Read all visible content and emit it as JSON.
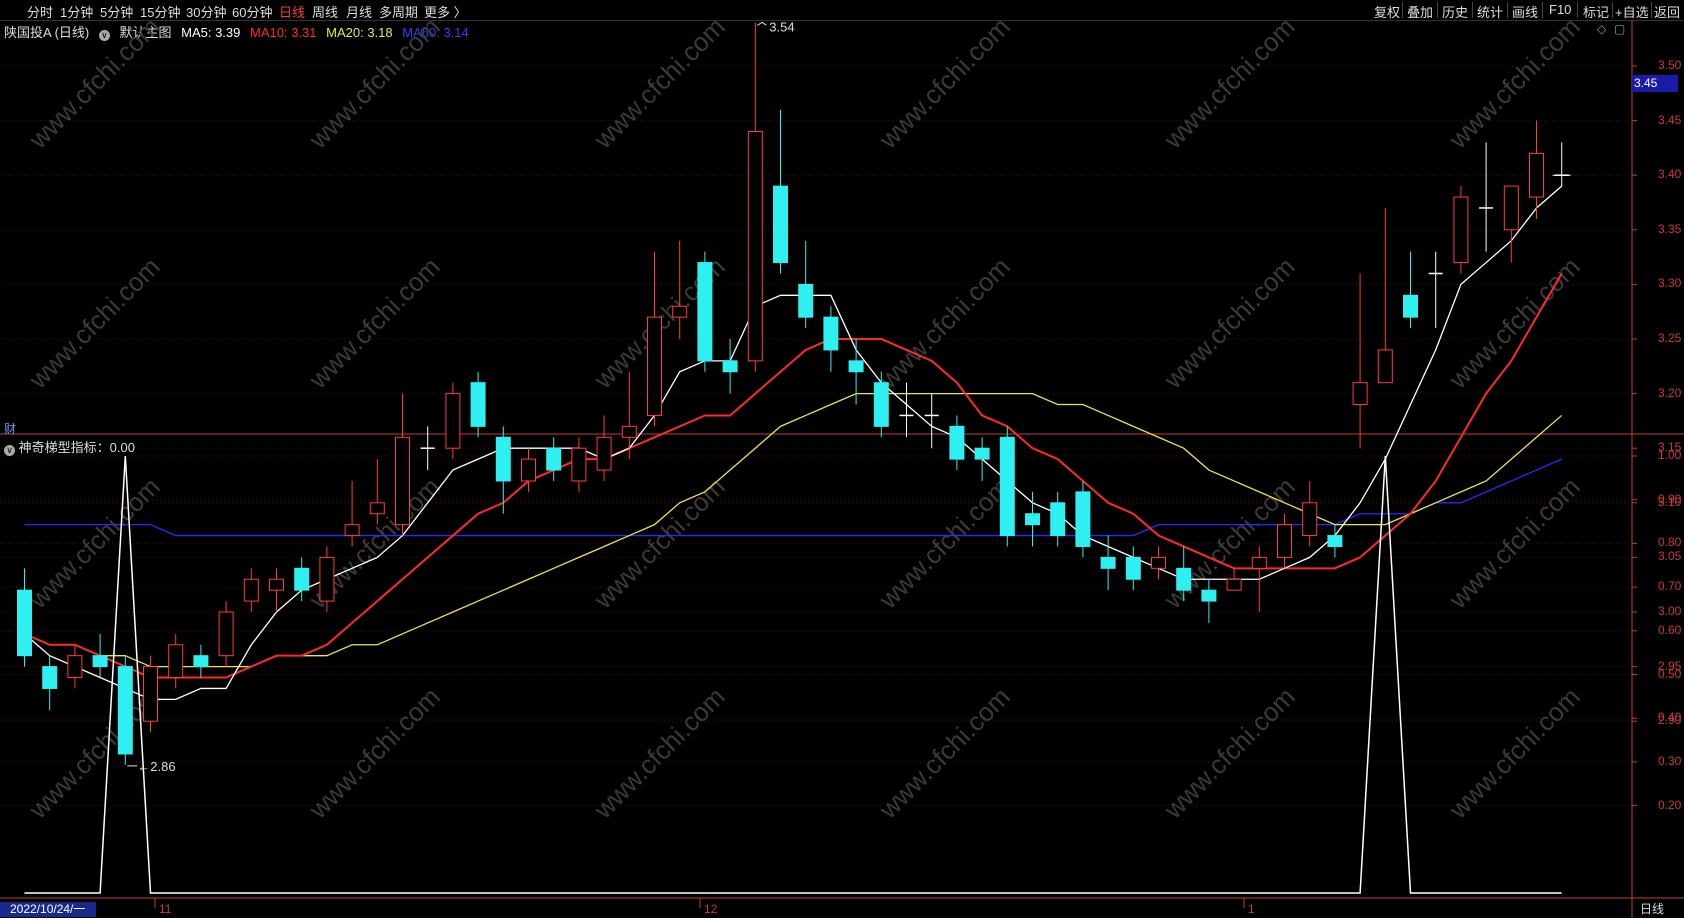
{
  "periods": [
    {
      "label": "分时",
      "active": false
    },
    {
      "label": "1分钟",
      "active": false
    },
    {
      "label": "5分钟",
      "active": false
    },
    {
      "label": "15分钟",
      "active": false
    },
    {
      "label": "30分钟",
      "active": false
    },
    {
      "label": "60分钟",
      "active": false
    },
    {
      "label": "日线",
      "active": true
    },
    {
      "label": "周线",
      "active": false
    },
    {
      "label": "月线",
      "active": false
    },
    {
      "label": "多周期",
      "active": false
    },
    {
      "label": "更多 〉",
      "active": false
    }
  ],
  "tools": [
    "复权",
    "叠加",
    "历史",
    "统计",
    "画线",
    "F10",
    "标记",
    "+自选",
    "返回"
  ],
  "legend": {
    "stock": "陕国投A (日线)",
    "template_label": "默认主图",
    "ma5": "MA5: 3.39",
    "ma10": "MA10: 3.31",
    "ma20": "MA20: 3.18",
    "ma60": "MA60: 3.14"
  },
  "colors": {
    "ma5": "#ffffff",
    "ma10": "#ff2a2a",
    "ma20": "#e8e83a",
    "ma60": "#2a2aff",
    "up": "#ff3b3b",
    "down": "#2ff0f0",
    "axis": "#c83a3a",
    "grid": "#5a0000"
  },
  "price_axis": [
    "3.50",
    "3.45",
    "3.40",
    "3.35",
    "3.30",
    "3.25",
    "3.20",
    "3.15",
    "3.10",
    "3.05",
    "3.00",
    "2.95",
    "2.90"
  ],
  "current_price": "3.45",
  "annotations": {
    "high": "3.54",
    "low": "2.86"
  },
  "indicator": {
    "label": "神奇梯型指标：0.00",
    "axis": [
      "1.00",
      "0.90",
      "0.80",
      "0.70",
      "0.60",
      "0.50",
      "0.40",
      "0.30",
      "0.20"
    ],
    "cai": "财"
  },
  "date_axis": {
    "start": "2022/10/24/一",
    "months": [
      "11",
      "12",
      "1"
    ]
  },
  "bottom_tab": "日线",
  "chart_data": {
    "type": "candlestick",
    "ylim": [
      2.86,
      3.54
    ],
    "candles": [
      [
        3.02,
        2.96,
        3.04,
        2.95
      ],
      [
        2.95,
        2.93,
        2.96,
        2.91
      ],
      [
        2.94,
        2.96,
        2.97,
        2.93
      ],
      [
        2.96,
        2.95,
        2.98,
        2.94
      ],
      [
        2.95,
        2.87,
        2.96,
        2.86
      ],
      [
        2.9,
        2.95,
        2.96,
        2.89
      ],
      [
        2.94,
        2.97,
        2.98,
        2.93
      ],
      [
        2.96,
        2.95,
        2.97,
        2.94
      ],
      [
        2.96,
        3.0,
        3.01,
        2.95
      ],
      [
        3.01,
        3.03,
        3.04,
        3.0
      ],
      [
        3.02,
        3.03,
        3.04,
        3.0
      ],
      [
        3.04,
        3.02,
        3.05,
        3.01
      ],
      [
        3.01,
        3.05,
        3.06,
        3.0
      ],
      [
        3.07,
        3.08,
        3.12,
        3.06
      ],
      [
        3.09,
        3.1,
        3.14,
        3.08
      ],
      [
        3.08,
        3.16,
        3.2,
        3.07
      ],
      [
        3.15,
        3.15,
        3.17,
        3.13
      ],
      [
        3.15,
        3.2,
        3.21,
        3.14
      ],
      [
        3.21,
        3.17,
        3.22,
        3.16
      ],
      [
        3.16,
        3.12,
        3.17,
        3.09
      ],
      [
        3.12,
        3.14,
        3.15,
        3.11
      ],
      [
        3.15,
        3.13,
        3.16,
        3.12
      ],
      [
        3.12,
        3.15,
        3.16,
        3.11
      ],
      [
        3.13,
        3.16,
        3.18,
        3.12
      ],
      [
        3.16,
        3.17,
        3.22,
        3.14
      ],
      [
        3.18,
        3.27,
        3.33,
        3.17
      ],
      [
        3.27,
        3.28,
        3.34,
        3.25
      ],
      [
        3.32,
        3.23,
        3.33,
        3.22
      ],
      [
        3.23,
        3.22,
        3.25,
        3.2
      ],
      [
        3.23,
        3.44,
        3.54,
        3.22
      ],
      [
        3.39,
        3.32,
        3.46,
        3.31
      ],
      [
        3.3,
        3.27,
        3.34,
        3.26
      ],
      [
        3.27,
        3.24,
        3.28,
        3.22
      ],
      [
        3.23,
        3.22,
        3.25,
        3.19
      ],
      [
        3.21,
        3.17,
        3.22,
        3.16
      ],
      [
        3.18,
        3.18,
        3.21,
        3.16
      ],
      [
        3.18,
        3.18,
        3.2,
        3.15
      ],
      [
        3.17,
        3.14,
        3.18,
        3.13
      ],
      [
        3.15,
        3.14,
        3.16,
        3.12
      ],
      [
        3.16,
        3.07,
        3.17,
        3.06
      ],
      [
        3.09,
        3.08,
        3.11,
        3.06
      ],
      [
        3.1,
        3.07,
        3.11,
        3.06
      ],
      [
        3.11,
        3.06,
        3.12,
        3.05
      ],
      [
        3.05,
        3.04,
        3.07,
        3.02
      ],
      [
        3.05,
        3.03,
        3.06,
        3.02
      ],
      [
        3.04,
        3.05,
        3.06,
        3.03
      ],
      [
        3.04,
        3.02,
        3.06,
        3.01
      ],
      [
        3.02,
        3.01,
        3.03,
        2.99
      ],
      [
        3.02,
        3.03,
        3.04,
        3.02
      ],
      [
        3.04,
        3.05,
        3.06,
        3.0
      ],
      [
        3.05,
        3.08,
        3.09,
        3.04
      ],
      [
        3.07,
        3.1,
        3.12,
        3.06
      ],
      [
        3.07,
        3.06,
        3.08,
        3.05
      ],
      [
        3.19,
        3.21,
        3.31,
        3.15
      ],
      [
        3.21,
        3.24,
        3.37,
        3.21
      ],
      [
        3.29,
        3.27,
        3.33,
        3.26
      ],
      [
        3.31,
        3.31,
        3.33,
        3.26
      ],
      [
        3.32,
        3.38,
        3.39,
        3.31
      ],
      [
        3.37,
        3.37,
        3.43,
        3.33
      ],
      [
        3.35,
        3.39,
        3.39,
        3.32
      ],
      [
        3.38,
        3.42,
        3.45,
        3.36
      ],
      [
        3.4,
        3.4,
        3.43,
        3.39
      ]
    ],
    "ma5": [
      2.98,
      2.96,
      2.95,
      2.94,
      2.93,
      2.92,
      2.92,
      2.93,
      2.93,
      2.97,
      3.0,
      3.02,
      3.03,
      3.04,
      3.05,
      3.07,
      3.1,
      3.13,
      3.14,
      3.15,
      3.15,
      3.15,
      3.15,
      3.14,
      3.15,
      3.18,
      3.22,
      3.23,
      3.23,
      3.28,
      3.29,
      3.29,
      3.29,
      3.24,
      3.21,
      3.19,
      3.17,
      3.16,
      3.14,
      3.12,
      3.1,
      3.09,
      3.07,
      3.06,
      3.05,
      3.04,
      3.03,
      3.03,
      3.03,
      3.03,
      3.04,
      3.05,
      3.07,
      3.1,
      3.14,
      3.19,
      3.24,
      3.3,
      3.32,
      3.34,
      3.37,
      3.39
    ],
    "ma10": [
      2.98,
      2.97,
      2.97,
      2.96,
      2.95,
      2.94,
      2.94,
      2.94,
      2.94,
      2.95,
      2.96,
      2.96,
      2.97,
      2.99,
      3.01,
      3.03,
      3.05,
      3.07,
      3.09,
      3.1,
      3.12,
      3.13,
      3.14,
      3.14,
      3.15,
      3.16,
      3.17,
      3.18,
      3.18,
      3.2,
      3.22,
      3.24,
      3.25,
      3.25,
      3.25,
      3.24,
      3.23,
      3.21,
      3.18,
      3.17,
      3.15,
      3.14,
      3.12,
      3.1,
      3.09,
      3.07,
      3.06,
      3.05,
      3.04,
      3.04,
      3.04,
      3.04,
      3.04,
      3.05,
      3.07,
      3.09,
      3.12,
      3.16,
      3.2,
      3.23,
      3.27,
      3.31
    ],
    "ma20": [
      2.98,
      2.97,
      2.97,
      2.96,
      2.96,
      2.95,
      2.95,
      2.95,
      2.95,
      2.95,
      2.96,
      2.96,
      2.96,
      2.97,
      2.97,
      2.98,
      2.99,
      3.0,
      3.01,
      3.02,
      3.03,
      3.04,
      3.05,
      3.06,
      3.07,
      3.08,
      3.1,
      3.11,
      3.13,
      3.15,
      3.17,
      3.18,
      3.19,
      3.2,
      3.2,
      3.2,
      3.2,
      3.2,
      3.2,
      3.2,
      3.2,
      3.19,
      3.19,
      3.18,
      3.17,
      3.16,
      3.15,
      3.13,
      3.12,
      3.11,
      3.1,
      3.09,
      3.08,
      3.08,
      3.08,
      3.09,
      3.1,
      3.11,
      3.12,
      3.14,
      3.16,
      3.18
    ],
    "ma60": [
      3.08,
      3.08,
      3.08,
      3.08,
      3.08,
      3.08,
      3.07,
      3.07,
      3.07,
      3.07,
      3.07,
      3.07,
      3.07,
      3.07,
      3.07,
      3.07,
      3.07,
      3.07,
      3.07,
      3.07,
      3.07,
      3.07,
      3.07,
      3.07,
      3.07,
      3.07,
      3.07,
      3.07,
      3.07,
      3.07,
      3.07,
      3.07,
      3.07,
      3.07,
      3.07,
      3.07,
      3.07,
      3.07,
      3.07,
      3.07,
      3.07,
      3.07,
      3.07,
      3.07,
      3.07,
      3.08,
      3.08,
      3.08,
      3.08,
      3.08,
      3.08,
      3.08,
      3.08,
      3.09,
      3.09,
      3.09,
      3.1,
      3.1,
      3.11,
      3.12,
      3.13,
      3.14
    ],
    "indicator": [
      0,
      0,
      0,
      0,
      1,
      0,
      0,
      0,
      0,
      0,
      0,
      0,
      0,
      0,
      0,
      0,
      0,
      0,
      0,
      0,
      0,
      0,
      0,
      0,
      0,
      0,
      0,
      0,
      0,
      0,
      0,
      0,
      0,
      0,
      0,
      0,
      0,
      0,
      0,
      0,
      0,
      0,
      0,
      0,
      0,
      0,
      0,
      0,
      0,
      0,
      0,
      0,
      0,
      0,
      1,
      0,
      0,
      0,
      0,
      0,
      0,
      0
    ]
  }
}
